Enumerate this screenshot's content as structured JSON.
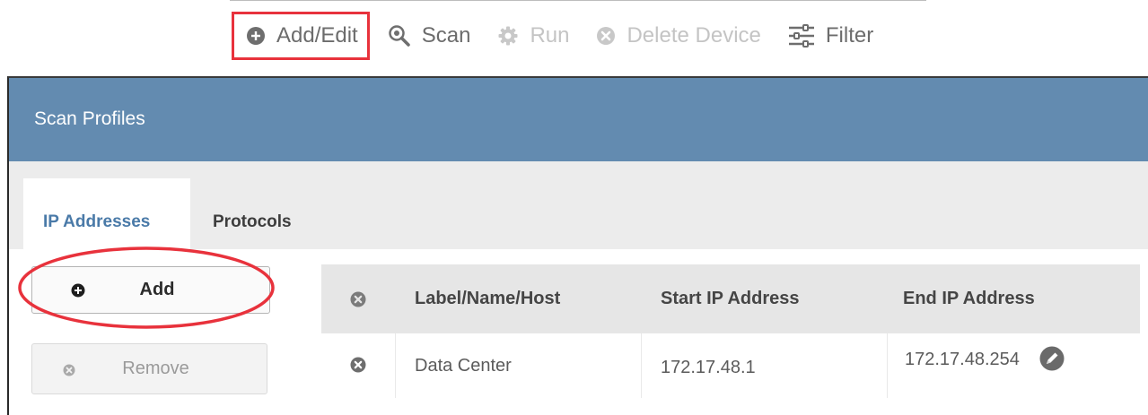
{
  "toolbar": {
    "items": [
      {
        "label": "Add/Edit",
        "icon": "plus-circle-icon",
        "state": "highlighted"
      },
      {
        "label": "Scan",
        "icon": "magnify-icon",
        "state": "enabled"
      },
      {
        "label": "Run",
        "icon": "gear-icon",
        "state": "disabled"
      },
      {
        "label": "Delete Device",
        "icon": "x-circle-icon",
        "state": "disabled"
      },
      {
        "label": "Filter",
        "icon": "sliders-icon",
        "state": "enabled"
      }
    ]
  },
  "panel": {
    "title": "Scan Profiles",
    "tabs": [
      {
        "label": "IP Addresses",
        "active": true
      },
      {
        "label": "Protocols",
        "active": false
      }
    ],
    "buttons": {
      "add": "Add",
      "remove": "Remove"
    },
    "table": {
      "columns": [
        "Label/Name/Host",
        "Start IP Address",
        "End IP Address"
      ],
      "rows": [
        {
          "label": "Data Center",
          "start_ip": "172.17.48.1",
          "end_ip": "172.17.48.254"
        }
      ]
    }
  },
  "colors": {
    "header_bg": "#638bb0",
    "highlight_red": "#e8323c",
    "active_tab_text": "#4a7aa8"
  }
}
